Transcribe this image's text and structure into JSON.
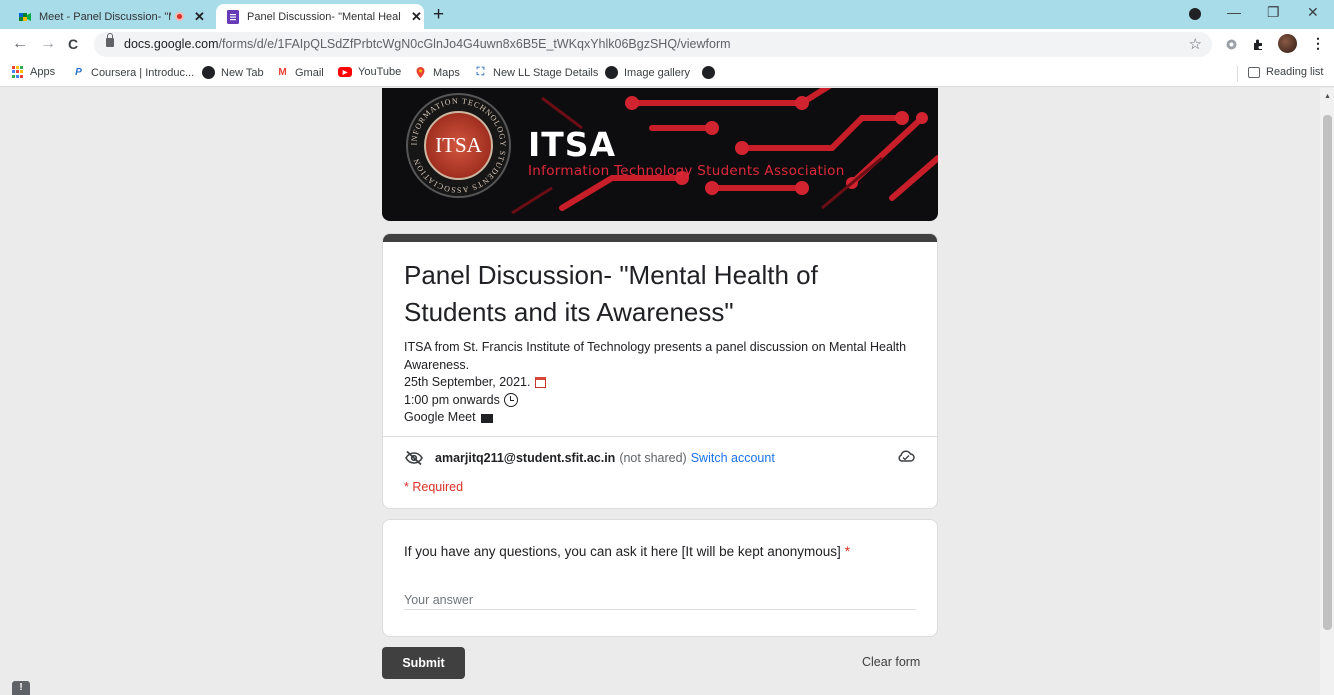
{
  "browser": {
    "tabs": [
      {
        "title": "Meet - Panel Discussion- \"Me",
        "active": false,
        "recording": true
      },
      {
        "title": "Panel Discussion- \"Mental Health",
        "active": true,
        "recording": false
      }
    ],
    "new_tab_symbol": "+",
    "close_symbol": "✕",
    "window_controls": {
      "minimize": "—",
      "restore": "❐",
      "close": "✕"
    },
    "url_host": "docs.google.com",
    "url_path": "/forms/d/e/1FAIpQLSdZfPrbtcWgN0cGlnJo4G4uwn8x6B5E_tWKqxYhlk06BgzSHQ/viewform",
    "nav": {
      "back": "←",
      "forward": "→",
      "reload": "C"
    },
    "star": "☆",
    "extension_icons": [
      "ext-puzzle-icon",
      "extensions-icon"
    ],
    "menu": "⋮",
    "bookmarks": [
      {
        "label": "Apps",
        "icon": "apps-grid-icon"
      },
      {
        "label": "Coursera | Introduc...",
        "icon": "coursera-icon"
      },
      {
        "label": "New Tab",
        "icon": "globe-icon"
      },
      {
        "label": "Gmail",
        "icon": "gmail-icon"
      },
      {
        "label": "YouTube",
        "icon": "youtube-icon"
      },
      {
        "label": "Maps",
        "icon": "maps-icon"
      },
      {
        "label": "New LL Stage Details",
        "icon": "ll-icon"
      },
      {
        "label": "Image gallery",
        "icon": "globe-icon"
      }
    ],
    "reading_list": "Reading list"
  },
  "banner": {
    "seal_text": "ITSA",
    "seal_ring_text": "INFORMATION TECHNOLOGY STUDENTS ASSOCIATION",
    "brand": "ITSA",
    "subtitle": "Information Technology Students Association"
  },
  "form": {
    "title": "Panel Discussion- \"Mental Health of Students and its Awareness\"",
    "description": {
      "line1": "ITSA from St. Francis Institute of Technology presents a panel discussion on Mental Health Awareness.",
      "date": "25th September, 2021.",
      "time": "1:00 pm onwards",
      "platform": "Google Meet"
    },
    "account": {
      "email": "amarjitq211@student.sfit.ac.in",
      "not_shared": "(not shared)",
      "switch": "Switch account"
    },
    "required_note": "* Required",
    "question": {
      "text": "If you have any questions, you can ask it here [It will be kept anonymous]",
      "required_mark": "*",
      "placeholder": "Your answer",
      "value": ""
    },
    "submit_label": "Submit",
    "clear_label": "Clear form"
  },
  "colors": {
    "tabstrip": "#a8dce9",
    "accent_dark": "#404040",
    "link": "#1a73e8",
    "required": "#d93025",
    "banner_red": "#e0283c"
  },
  "feedback_icon": "!"
}
